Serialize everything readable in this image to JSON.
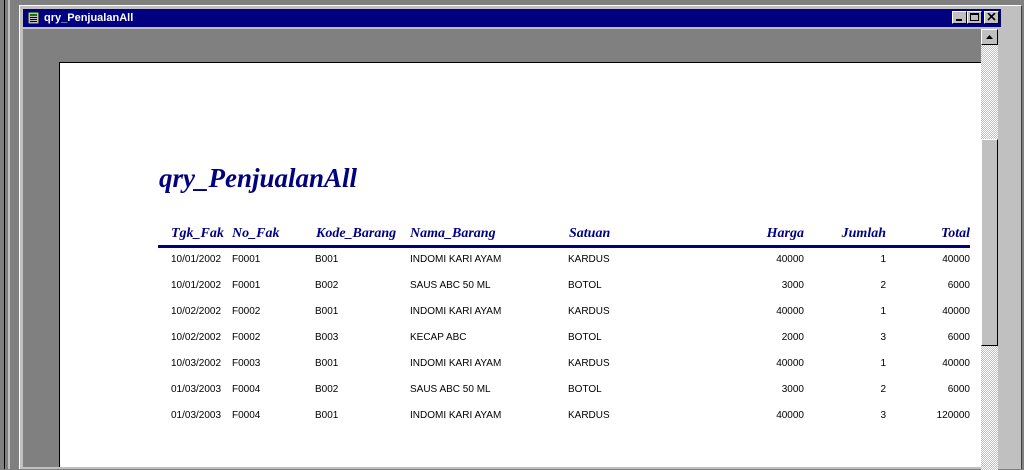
{
  "window": {
    "title": "qry_PenjualanAll"
  },
  "report": {
    "title": "qry_PenjualanAll",
    "columns": [
      "Tgk_Fak",
      "No_Fak",
      "Kode_Barang",
      "Nama_Barang",
      "Satuan",
      "Harga",
      "Jumlah",
      "Total"
    ],
    "rows": [
      [
        "10/01/2002",
        "F0001",
        "B001",
        "INDOMI KARI AYAM",
        "KARDUS",
        "40000",
        "1",
        "40000"
      ],
      [
        "10/01/2002",
        "F0001",
        "B002",
        "SAUS ABC 50 ML",
        "BOTOL",
        "3000",
        "2",
        "6000"
      ],
      [
        "10/02/2002",
        "F0002",
        "B001",
        "INDOMI KARI AYAM",
        "KARDUS",
        "40000",
        "1",
        "40000"
      ],
      [
        "10/02/2002",
        "F0002",
        "B003",
        "KECAP ABC",
        "BOTOL",
        "2000",
        "3",
        "6000"
      ],
      [
        "10/03/2002",
        "F0003",
        "B001",
        "INDOMI KARI AYAM",
        "KARDUS",
        "40000",
        "1",
        "40000"
      ],
      [
        "01/03/2003",
        "F0004",
        "B002",
        "SAUS ABC 50 ML",
        "BOTOL",
        "3000",
        "2",
        "6000"
      ],
      [
        "01/03/2003",
        "F0004",
        "B001",
        "INDOMI KARI AYAM",
        "KARDUS",
        "40000",
        "3",
        "120000"
      ]
    ]
  }
}
